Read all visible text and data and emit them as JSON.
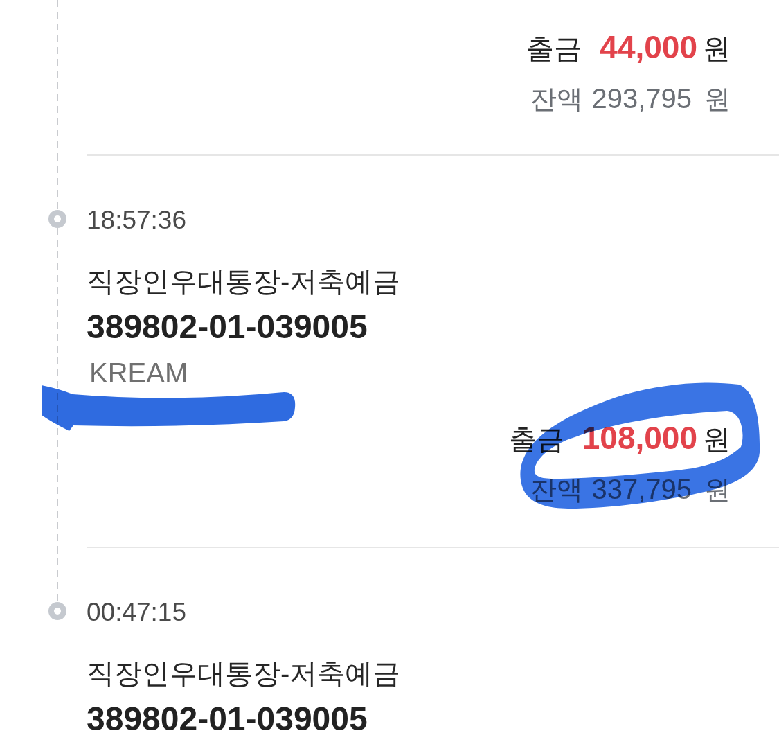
{
  "transactions": [
    {
      "kind": "withdrawal",
      "type_label": "출금",
      "amount": "44,000",
      "amount_unit": "원",
      "balance_label": "잔액",
      "balance": "293,795",
      "balance_unit": "원"
    },
    {
      "kind": "withdrawal",
      "time": "18:57:36",
      "account_name": "직장인우대통장-저축예금",
      "account_number": "389802-01-039005",
      "memo": "KREAM",
      "memo_underlined": true,
      "type_label": "출금",
      "amount": "108,000",
      "amount_unit": "원",
      "balance_label": "잔액",
      "balance": "337,795",
      "balance_unit": "원",
      "amount_circled": true
    },
    {
      "time": "00:47:15",
      "account_name": "직장인우대통장-저축예금",
      "account_number": "389802-01-039005"
    }
  ]
}
